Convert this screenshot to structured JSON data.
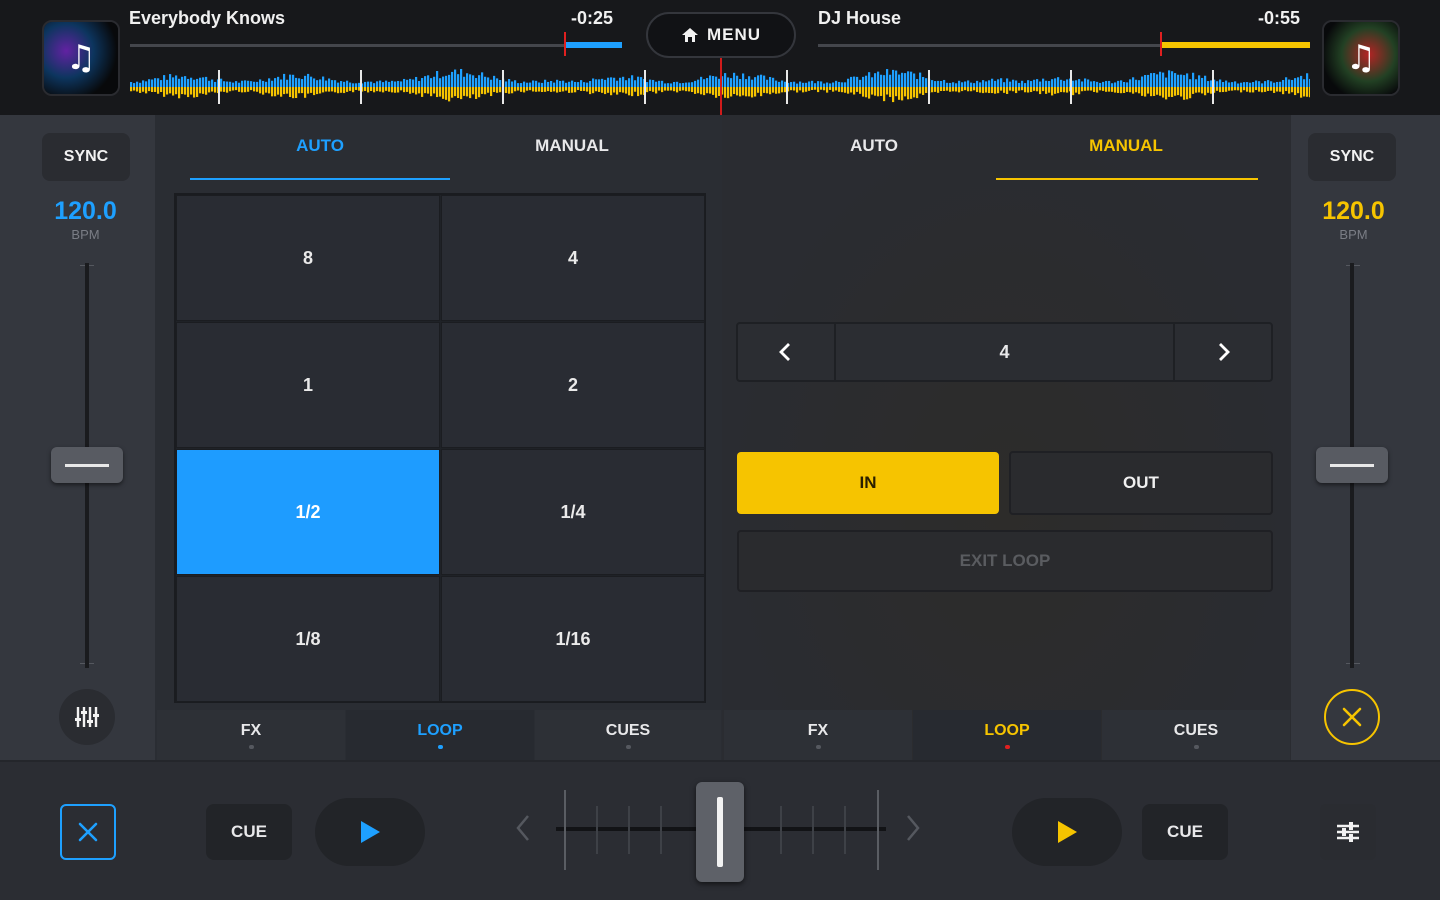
{
  "colors": {
    "blue": "#1ea0ff",
    "yellow": "#f6c400",
    "red": "#e02020",
    "background": "#2c2f35",
    "topbar": "#17181b"
  },
  "topbar": {
    "left_deck": {
      "title": "Everybody Knows",
      "time": "-0:25",
      "icon": "music-note-icon"
    },
    "right_deck": {
      "title": "DJ House",
      "time": "-0:55",
      "icon": "music-note-icon"
    },
    "menu": {
      "label": "MENU",
      "icon": "home-icon"
    }
  },
  "left_side": {
    "sync_label": "SYNC",
    "bpm_value": "120.0",
    "bpm_unit": "BPM",
    "bottom_icon": "mixer-sliders-icon"
  },
  "right_side": {
    "sync_label": "SYNC",
    "bpm_value": "120.0",
    "bpm_unit": "BPM",
    "bottom_icon": "close-icon"
  },
  "left_panel": {
    "tabs": [
      "AUTO",
      "MANUAL"
    ],
    "active_tab": "AUTO",
    "pads": [
      "8",
      "4",
      "1",
      "2",
      "1/2",
      "1/4",
      "1/8",
      "1/16"
    ],
    "active_pad": "1/2"
  },
  "right_panel": {
    "tabs": [
      "AUTO",
      "MANUAL"
    ],
    "active_tab": "MANUAL",
    "loop_size": "4",
    "prev_icon": "chevron-left-icon",
    "next_icon": "chevron-right-icon",
    "in_label": "IN",
    "out_label": "OUT",
    "exit_label": "EXIT LOOP"
  },
  "bottom_tabs": {
    "left": [
      "FX",
      "LOOP",
      "CUES"
    ],
    "right": [
      "FX",
      "LOOP",
      "CUES"
    ],
    "active": "LOOP"
  },
  "transport": {
    "left_cue": "CUE",
    "right_cue": "CUE",
    "left_close_icon": "close-icon",
    "right_eq_icon": "equalizer-icon",
    "left_play_icon": "play-icon",
    "right_play_icon": "play-icon",
    "crossfader_left_icon": "chevron-left-icon",
    "crossfader_right_icon": "chevron-right-icon"
  }
}
